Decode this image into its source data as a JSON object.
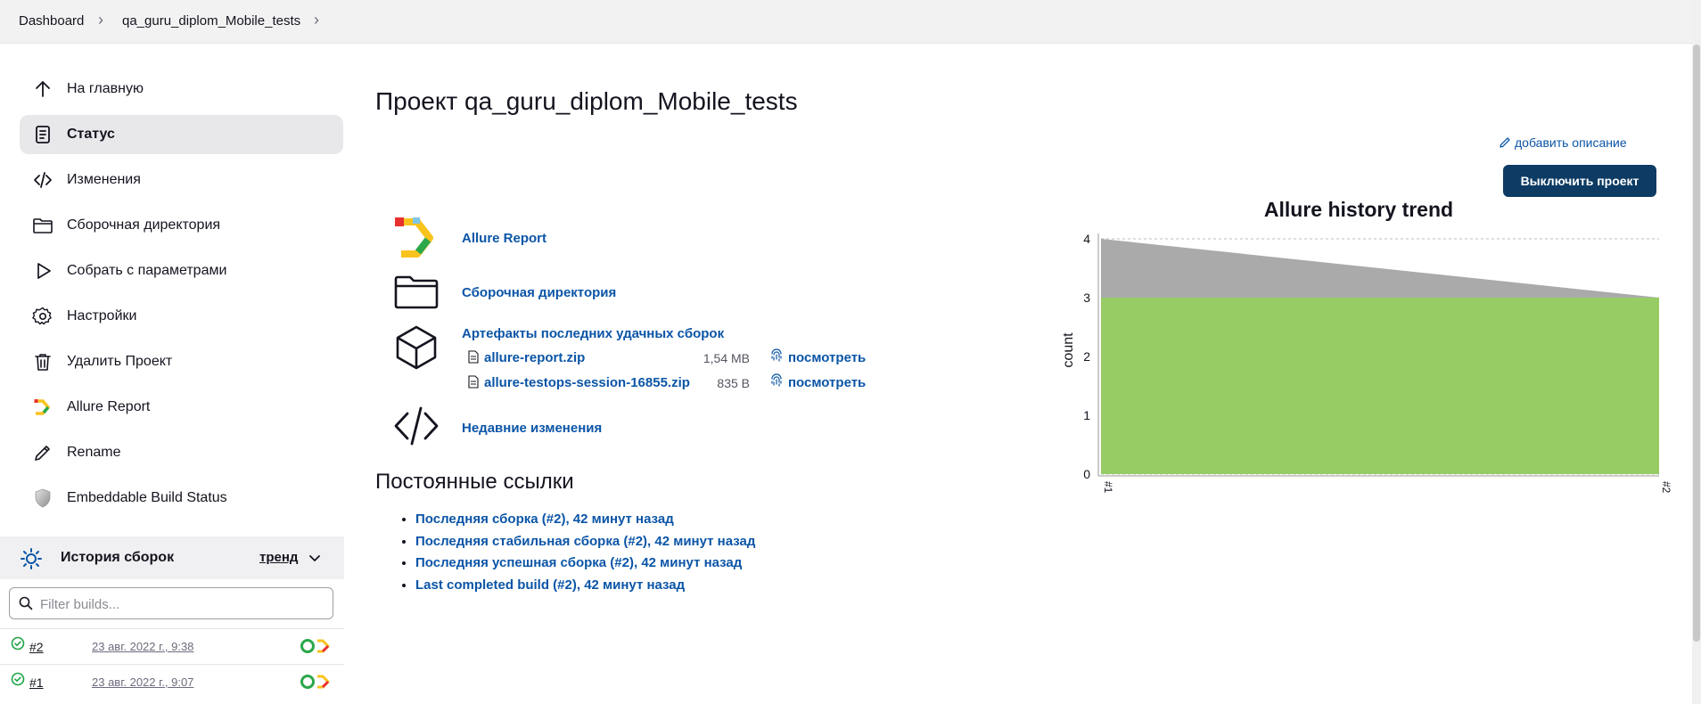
{
  "breadcrumb": {
    "items": [
      "Dashboard",
      "qa_guru_diplom_Mobile_tests"
    ]
  },
  "sidebar": {
    "items": [
      {
        "label": "На главную",
        "icon": "arrow-up-icon",
        "active": false
      },
      {
        "label": "Статус",
        "icon": "document-icon",
        "active": true
      },
      {
        "label": "Изменения",
        "icon": "code-icon",
        "active": false
      },
      {
        "label": "Сборочная директория",
        "icon": "folder-icon",
        "active": false
      },
      {
        "label": "Собрать с параметрами",
        "icon": "play-icon",
        "active": false
      },
      {
        "label": "Настройки",
        "icon": "gear-icon",
        "active": false
      },
      {
        "label": "Удалить Проект",
        "icon": "trash-icon",
        "active": false
      },
      {
        "label": "Allure Report",
        "icon": "allure-logo-icon",
        "active": false
      },
      {
        "label": "Rename",
        "icon": "pencil-icon",
        "active": false
      },
      {
        "label": "Embeddable Build Status",
        "icon": "shield-icon",
        "active": false
      }
    ]
  },
  "build_history": {
    "title": "История сборок",
    "trend_label": "тренд",
    "filter_placeholder": "Filter builds...",
    "builds": [
      {
        "number": "#2",
        "date": "23 авг. 2022 г., 9:38",
        "status": "success"
      },
      {
        "number": "#1",
        "date": "23 авг. 2022 г., 9:07",
        "status": "success"
      }
    ]
  },
  "main": {
    "title": "Проект qa_guru_diplom_Mobile_tests",
    "add_description": "добавить описание",
    "disable_button": "Выключить проект",
    "links": {
      "allure_report": "Allure Report",
      "workspace": "Сборочная директория",
      "artifacts_title": "Артефакты последних удачных сборок",
      "recent_changes": "Недавние изменения"
    },
    "artifacts": [
      {
        "name": "allure-report.zip",
        "size": "1,54 MB",
        "view": "посмотреть"
      },
      {
        "name": "allure-testops-session-16855.zip",
        "size": "835 B",
        "view": "посмотреть"
      }
    ],
    "permalinks_title": "Постоянные ссылки",
    "permalinks": [
      "Последняя сборка (#2), 42 минут назад",
      "Последняя стабильная сборка (#2), 42 минут назад",
      "Последняя успешная сборка (#2), 42 минут назад",
      "Last completed build (#2), 42 минут назад"
    ]
  },
  "colors": {
    "link": "#0b55a7",
    "button": "#0d3b63",
    "passed": "#97cc64",
    "other": "#aaaaaa",
    "active_bg": "#e8e8ea"
  },
  "chart_data": {
    "type": "area",
    "title": "Allure history trend",
    "xlabel": "",
    "ylabel": "count",
    "categories": [
      "#1",
      "#2"
    ],
    "yticks": [
      0,
      1,
      2,
      3,
      4
    ],
    "ylim": [
      0,
      4
    ],
    "grid": true,
    "stacked": true,
    "series": [
      {
        "values": [
          3,
          3
        ],
        "color": "#97cc64"
      },
      {
        "values": [
          1,
          0
        ],
        "color": "#aaaaaa"
      }
    ]
  }
}
